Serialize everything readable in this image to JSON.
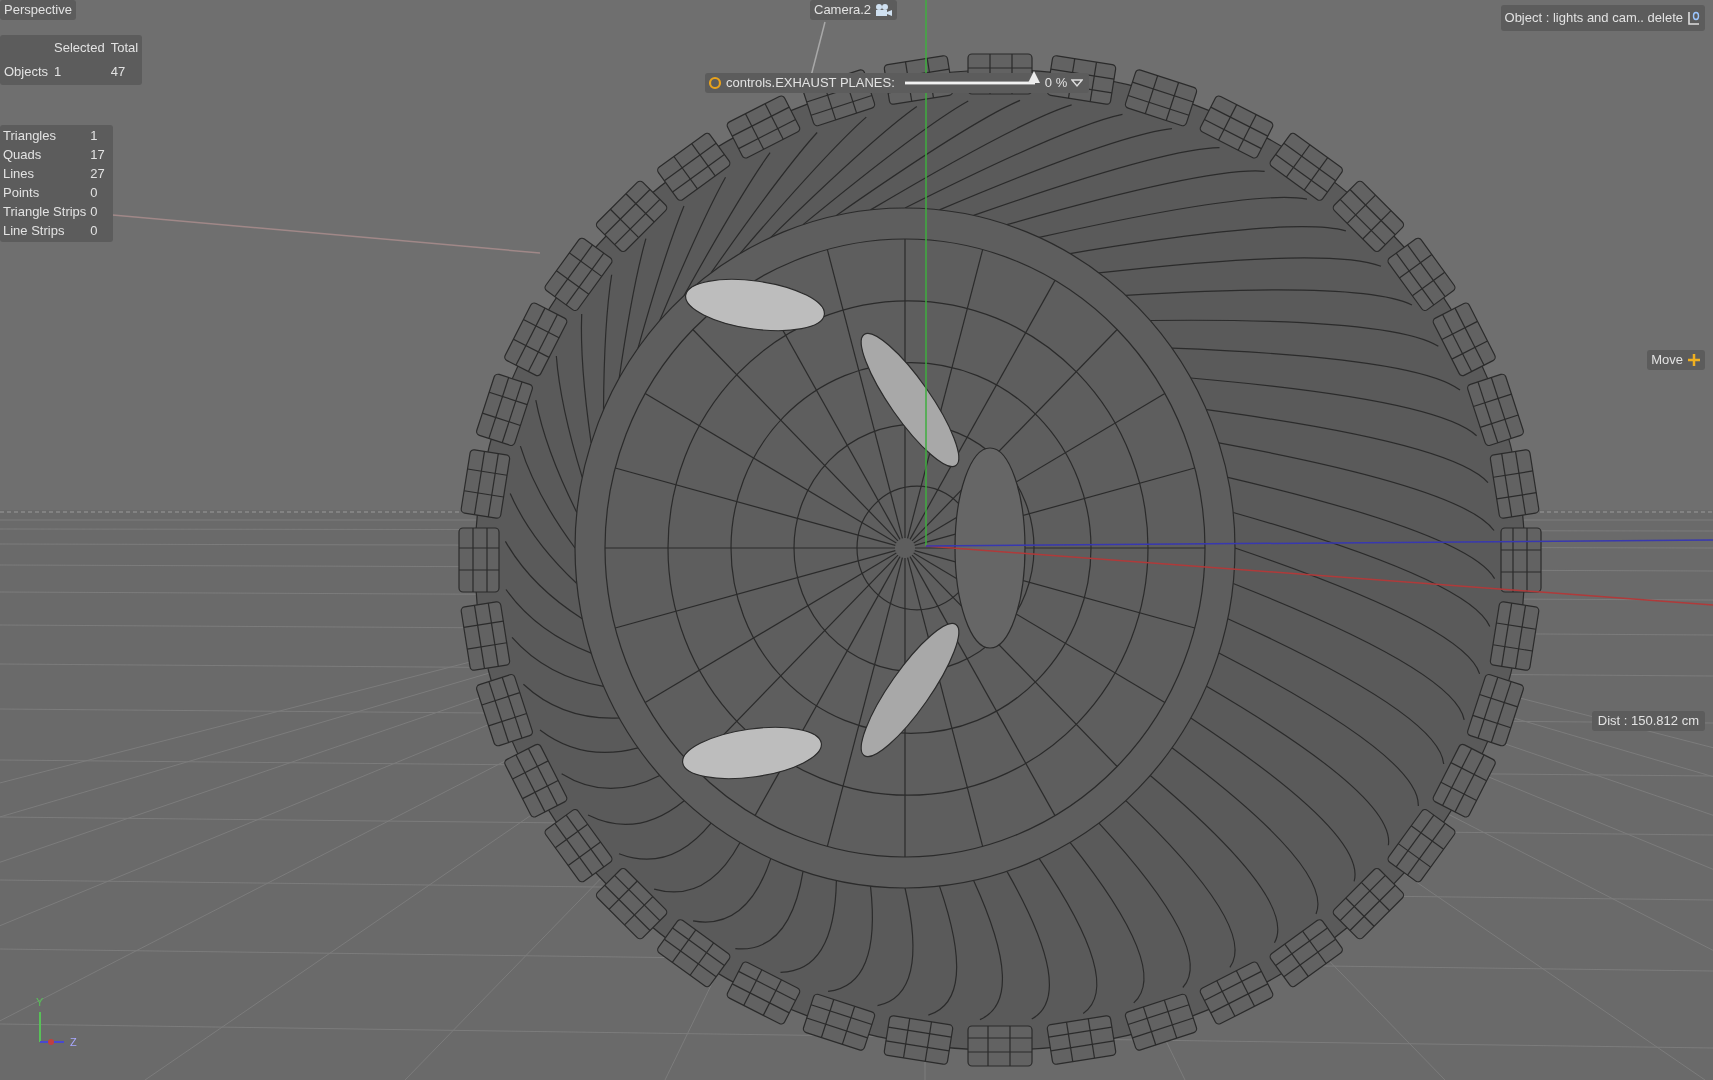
{
  "viewport": {
    "name": "Perspective"
  },
  "camera": {
    "label": "Camera.2"
  },
  "object_count": {
    "columns": [
      "Selected",
      "Total"
    ],
    "rows": [
      {
        "label": "Objects",
        "selected_count": "1",
        "total": "47"
      }
    ]
  },
  "polygon_stats": [
    {
      "label": "Triangles",
      "value": "1"
    },
    {
      "label": "Quads",
      "value": "17"
    },
    {
      "label": "Lines",
      "value": "27"
    },
    {
      "label": "Points",
      "value": "0"
    },
    {
      "label": "Triangle Strips",
      "value": "0"
    },
    {
      "label": "Line Strips",
      "value": "0"
    }
  ],
  "exhaust_control": {
    "label": "controls.EXHAUST PLANES:",
    "level": 1,
    "reading": "0 %"
  },
  "object_info": "Object : lights and cam.. delete",
  "tool": "Move",
  "distance": "Dist : 150.812 cm",
  "axis_gizmo": {
    "labels": [
      "Y",
      "Z"
    ]
  }
}
